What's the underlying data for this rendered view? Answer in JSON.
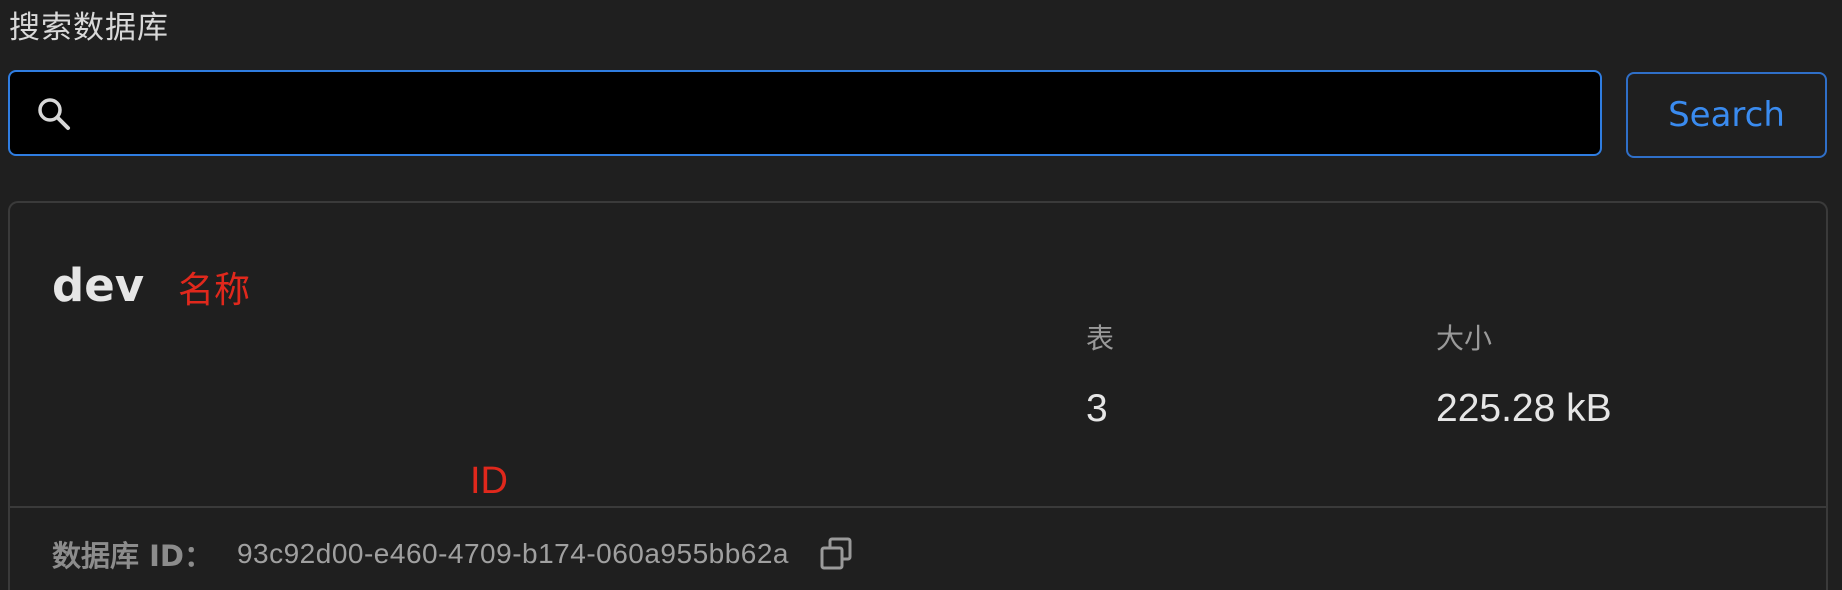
{
  "search": {
    "label": "搜索数据库",
    "value": "",
    "placeholder": "",
    "button_label": "Search",
    "icon": "search-icon"
  },
  "database": {
    "name": "dev",
    "stats": {
      "tables_label": "表",
      "tables_value": "3",
      "size_label": "大小",
      "size_value": "225.28 kB"
    },
    "id_label": "数据库 ID：",
    "id_value": "93c92d00-e460-4709-b174-060a955bb62a",
    "copy_icon": "copy-icon"
  },
  "annotations": {
    "name_note": "名称",
    "id_note": "ID"
  },
  "colors": {
    "background": "#1f1f1f",
    "accent": "#2f7de1",
    "annotation": "#e0281c",
    "border": "#3a3a3a"
  }
}
